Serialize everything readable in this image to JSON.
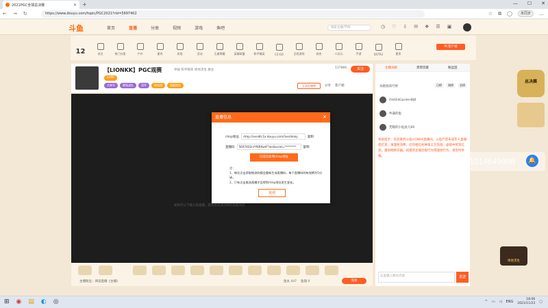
{
  "browser": {
    "tab_title": "2021PGC全球总决赛",
    "url": "https://www.douyu.com/topic/PGC2021?rid=5697402",
    "not_synced": "未同步"
  },
  "site": {
    "logo": "斗鱼",
    "menu": [
      "首页",
      "直播",
      "分类",
      "视频",
      "游戏",
      "鱼吧"
    ],
    "menu_active_index": 1,
    "search_placeholder": "搜索主播/节目",
    "pc_client": "PC客户端"
  },
  "categories": {
    "count": "12",
    "labels": [
      "关注",
      "热门分类",
      "户外",
      "星秀",
      "发现",
      "活动",
      "王者荣耀",
      "英雄联盟",
      "和平精英",
      "CS:GO",
      "主机游戏",
      "综合",
      "二次元",
      "手游",
      "DOTA2",
      "更多"
    ]
  },
  "room": {
    "title": "【LIONKK】PGC观赛",
    "subtitle": "举报  和平精英  绝地求生  群主",
    "fans": "137866",
    "follow": "关注",
    "anchor_level": "LV46",
    "tags": [
      "大神号",
      "最强战队",
      "冠军",
      "粉丝团",
      "超级粉丝"
    ],
    "report": "互动礼物榜",
    "share": [
      "分享",
      "客户端"
    ],
    "player_hint": "如你可以下载斗鱼直播，获得更高清流畅的观看体验"
  },
  "bottom": {
    "text": "主播粉丝：阅读直播《主播》",
    "stats": [
      "鱼丸 447",
      "鱼翅 0"
    ],
    "recharge": "充值"
  },
  "side": {
    "tabs": [
      "主播贡献",
      "贵宾玩家",
      "粉丝团"
    ],
    "active_tab": 0,
    "rank_head": "贡献值排行榜",
    "rank_tabs": [
      "日榜",
      "周榜",
      "总榜"
    ],
    "ranks": [
      "OldOldGardenBJB",
      "牛逼的鱼",
      "无敌的小仙女儿66"
    ],
    "notice": "系统提示：欢迎来到斗鱼LIONKK直播间。斗鱼严禁未成年人直播或打赏，请理性消费，切勿相信各种第三方充值、虚假中奖等信息，谨防网络诈骗。如遇到主播违规行为或骚扰行为，请及时举报。",
    "chat_placeholder": "这里输入聊天内容",
    "send": "发送"
  },
  "qq_overlay": "QQ2群：1014649998",
  "dialog": {
    "title": "直播信息",
    "rtmp_label": "rtmp地址",
    "rtmp_value": "rtmp://sendtc1a.douyu.com/live/delay",
    "key_label": "直播码",
    "key_value": "5697402rzYf6R9wtF?wsSecret=********",
    "copy": "复制",
    "tooltip": "已成功复制rtmp地址",
    "notes": "注：\n1、每次点击获取推流码都会重新生成直播码，每个直播码的有效期为5分钟。\n2、只有点击推流直播才会得到rtmp地址发生变化。",
    "confirm": "关闭"
  },
  "taskbar": {
    "lang": "ENG",
    "time": "18:06",
    "date": "2021/11/23"
  },
  "promos": {
    "promo1": "总决赛",
    "promo3": "绝地求生"
  }
}
